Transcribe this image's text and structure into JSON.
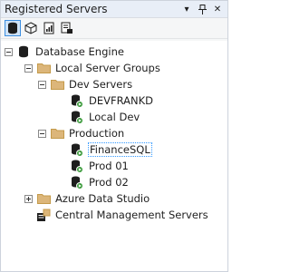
{
  "panel": {
    "title": "Registered Servers"
  },
  "tree": {
    "root": "Database Engine",
    "local_groups": "Local Server Groups",
    "dev_servers": "Dev Servers",
    "devfrankd": "DEVFRANKD",
    "local_dev": "Local Dev",
    "production": "Production",
    "finance_sql": "FinanceSQL",
    "prod01": "Prod 01",
    "prod02": "Prod 02",
    "azure_ds": "Azure Data Studio",
    "cms": "Central Management Servers"
  },
  "colors": {
    "folder": "#dcb67a",
    "accent": "#3399ff",
    "server_ok": "#3a9a3a"
  }
}
